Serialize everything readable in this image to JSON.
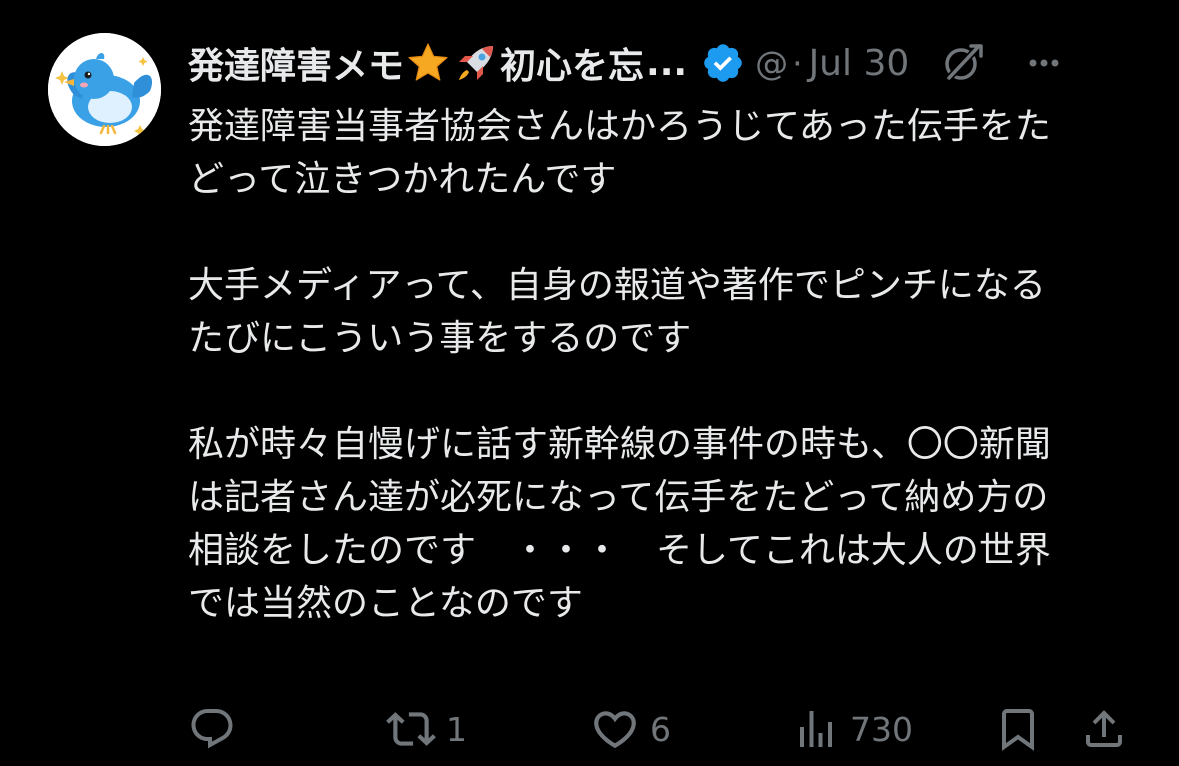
{
  "tweet": {
    "display_name": "発達障害メモ",
    "display_name_suffix": "初心を忘",
    "ellipsis": "...",
    "handle": "@",
    "separator": "·",
    "date": "Jul 30",
    "body": "発達障害当事者協会さんはかろうじてあった伝手をた\nどって泣きつかれたんです\n\n大手メディアって、自身の報道や著作でピンチになる\nたびにこういう事をするのです\n\n私が時々自慢げに話す新幹線の事件の時も、〇〇新聞\nは記者さん達が必死になって伝手をたどって納め方の\n相談をしたのです　・・・　そしてこれは大人の世界\nでは当然のことなのです"
  },
  "icons": {
    "avatar": "bird-avatar",
    "emoji_1": "star-emoji",
    "emoji_2": "rocket-emoji",
    "verified": "verified-badge-icon",
    "grok": "grok-icon",
    "more": "more-icon",
    "reply": "reply-icon",
    "repost": "repost-icon",
    "like": "like-icon",
    "views": "views-icon",
    "bookmark": "bookmark-icon",
    "share": "share-icon"
  },
  "actions": {
    "reply_count": "",
    "repost_count": "1",
    "like_count": "6",
    "views_count": "730"
  },
  "colors": {
    "background": "#000000",
    "text": "#e7e9ea",
    "secondary": "#71767b",
    "verified": "#1d9bf0"
  }
}
